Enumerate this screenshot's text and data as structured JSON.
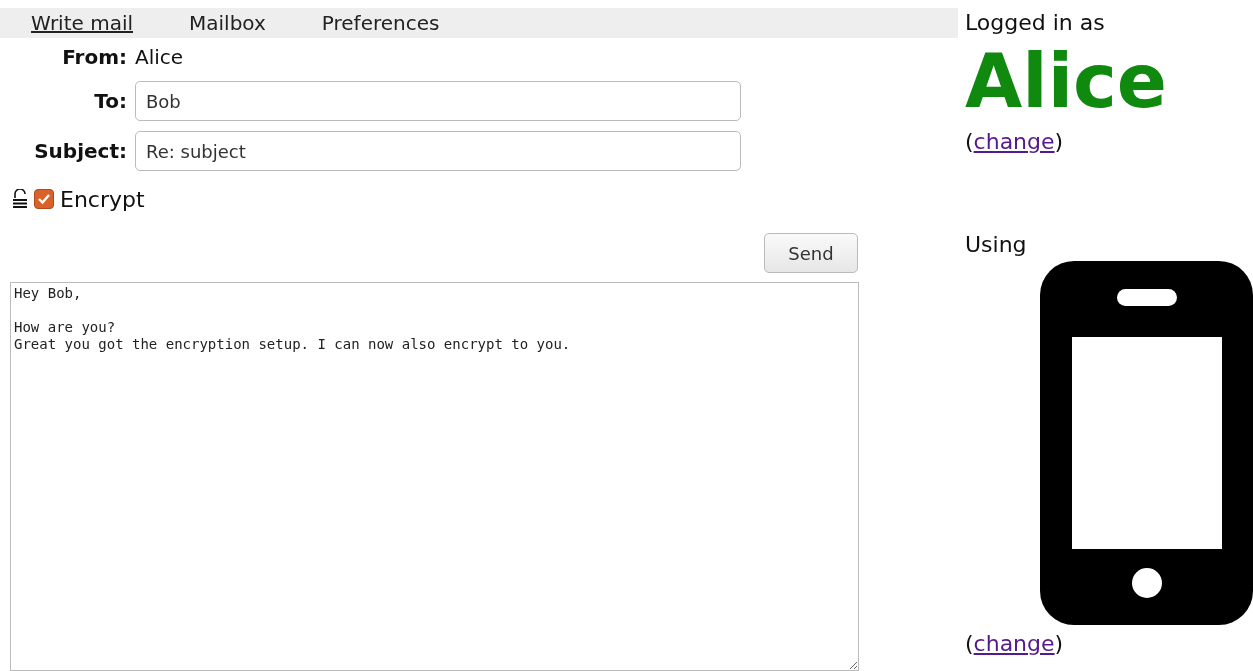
{
  "nav": [
    {
      "label": "Write mail",
      "selected": true
    },
    {
      "label": "Mailbox",
      "selected": false
    },
    {
      "label": "Preferences",
      "selected": false
    }
  ],
  "compose": {
    "from_label": "From:",
    "from_value": "Alice",
    "fields": [
      {
        "label": "To:",
        "value": "Bob"
      },
      {
        "label": "Subject:",
        "value": "Re: subject"
      }
    ],
    "encrypt": {
      "label": "Encrypt",
      "checked": true
    },
    "send_button": "Send",
    "body": "Hey Bob,\n\nHow are you?\nGreat you got the encryption setup. I can now also encrypt to you."
  },
  "sidebar": {
    "logged_in_label": "Logged in as",
    "user": "Alice",
    "user_change": {
      "open": "(",
      "link": "change",
      "close": ")"
    },
    "using_label": "Using",
    "device_change": {
      "open": "(",
      "link": "change",
      "close": ")"
    }
  }
}
